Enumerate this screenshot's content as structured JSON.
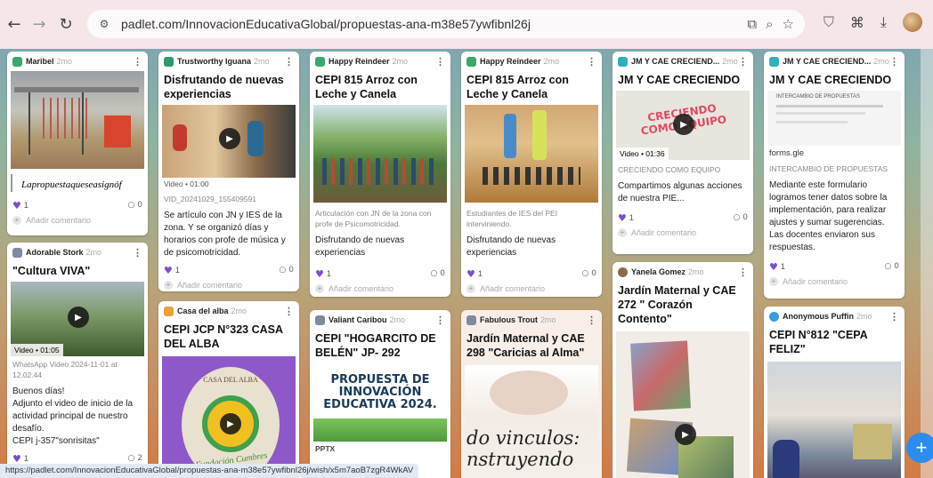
{
  "browser": {
    "url": "padlet.com/InnovacionEducativaGlobal/propuestas-ana-m38e57ywfibnl26j",
    "status_url": "https://padlet.com/InnovacionEducativaGlobal/propuestas-ana-m38e57ywfibnl26j/wish/x5m7aoB7zgR4WkAV"
  },
  "common": {
    "add_comment": "Añadir comentario",
    "ago": "2mo",
    "likes_1": "1",
    "comments_0": "0"
  },
  "cards": {
    "maribel": {
      "author": "Maribel",
      "caption": "Lapropuestaqueseasignóf"
    },
    "iguana": {
      "author": "Trustworthy Iguana",
      "title": "Disfrutando de nuevas experiencias",
      "video_dur": "Video • 01:00",
      "file": "VID_20241029_155409591",
      "text": "Se artículo con JN y IES de la zona. Y se organizó días y horarios con profe de música y de psicomotricidad."
    },
    "reindeer1": {
      "author": "Happy Reindeer",
      "title": "CEPI 815 Arroz con Leche y Canela",
      "subtext": "Articulación con JN de la zona con profe de Psicomotricidad.",
      "text": "Disfrutando de nuevas experiencias"
    },
    "reindeer2": {
      "author": "Happy Reindeer",
      "title": "CEPI 815 Arroz con Leche y Canela",
      "subtext": "Estudiantes de IES del PEI interviniendo.",
      "text": "Disfrutando de nuevas experiencias"
    },
    "jm1": {
      "author": "JM Y CAE CRECIEND...",
      "title": "JM Y CAE CRECIENDO",
      "thumb_text": "CRECIENDO COMO EQUIPO",
      "video_dur": "Video • 01:36",
      "subtext": "CRECIENDO COMO EQUIPO",
      "text": "Compartimos algunas acciones de nuestra PIE..."
    },
    "jm2": {
      "author": "JM Y CAE CRECIEND...",
      "title": "JM Y CAE CRECIENDO",
      "thumb_text": "INTERCAMBIO DE PROPUESTAS",
      "link": "forms.gle",
      "subtext": "INTERCAMBIO DE PROPUESTAS",
      "text": "Mediante este formulario logramos tener datos sobre la implementación, para realizar ajustes y sumar sugerencias. Las docentes enviaron sus respuestas."
    },
    "stork": {
      "author": "Adorable Stork",
      "title": "\"Cultura VIVA\"",
      "video_dur": "Video • 01:05",
      "file": "WhatsApp Video 2024-11-01 at 12.02.44",
      "text": "Buenos días!\nAdjunto el video  de inicio de la actividad principal de nuestro desafío.\nCEPI  j-357\"sonrisitas\"",
      "likes": "1",
      "comments": "2"
    },
    "alba": {
      "author": "Casa del alba",
      "title": "CEPI JCP N°323 CASA DEL ALBA",
      "sign_top": "CASA DEL ALBA",
      "sign_bottom": "Fundación Cumbres"
    },
    "caribou": {
      "author": "Valiant Caribou",
      "title": "CEPI  \"HOGARCITO DE BELÉN\"  JP- 292",
      "poster": "PROPUESTA DE INNOVACIÓN EDUCATIVA 2024.",
      "file_type": "PPTX"
    },
    "trout": {
      "author": "Fabulous Trout",
      "title": "Jardín Maternal y CAE 298 \"Caricias al Alma\"",
      "big_text": "do vinculos: nstruyendo"
    },
    "yanela": {
      "author": "Yanela Gomez",
      "title": "Jardín Maternal y CAE 272 \" Corazón Contento\""
    },
    "puffin": {
      "author": "Anonymous Puffin",
      "title": "CEPI N°812 \"CEPA FELIZ\""
    }
  }
}
